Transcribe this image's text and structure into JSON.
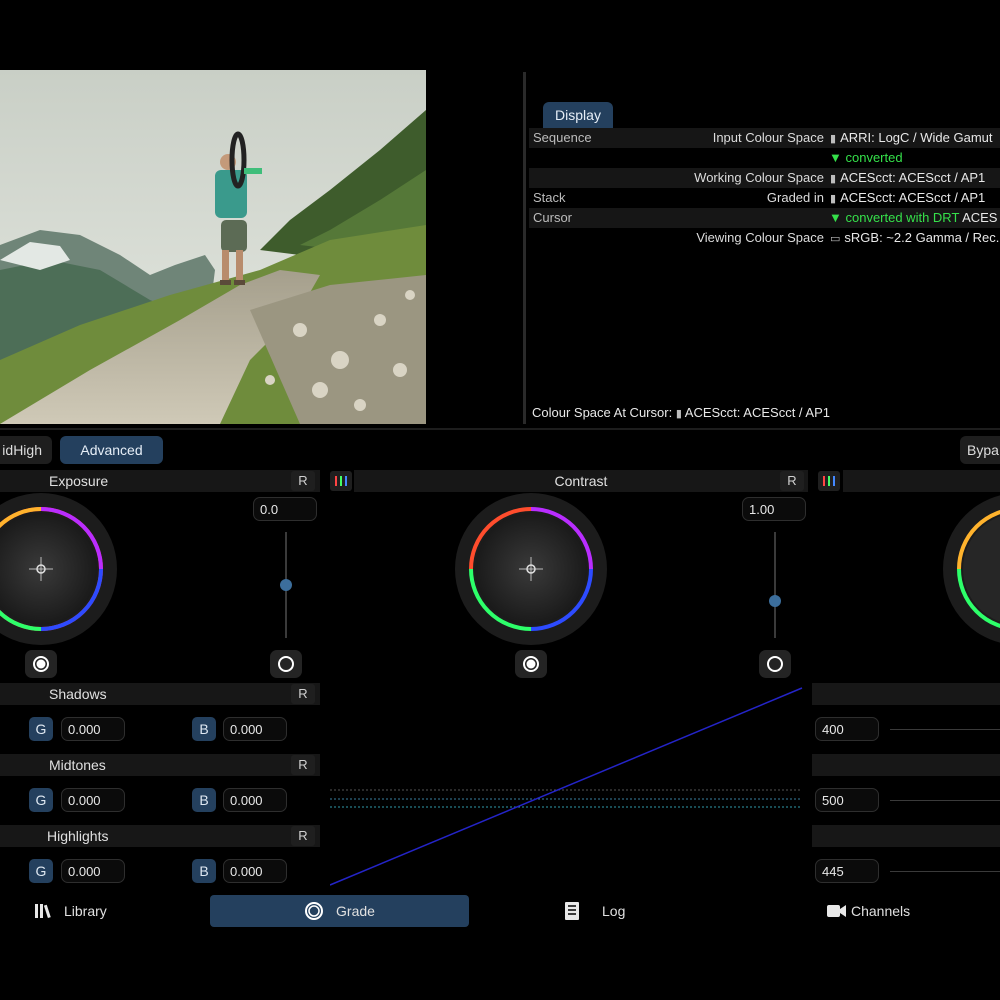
{
  "display_panel": {
    "tab_label": "Display",
    "rows": [
      {
        "left": "Sequence",
        "label": "Input Colour Space",
        "icon": "camera-icon",
        "value": "ARRI: LogC / Wide Gamut"
      },
      {
        "left": "",
        "label": "",
        "green": "converted",
        "white": ""
      },
      {
        "left": "",
        "label": "Working Colour Space",
        "icon": "camera-icon",
        "value": "ACEScct: ACEScct / AP1"
      },
      {
        "left": "Stack",
        "label": "Graded in",
        "icon": "camera-icon",
        "value": "ACEScct: ACEScct / AP1"
      },
      {
        "left": "Cursor",
        "label": "",
        "green": "converted with DRT",
        "white": "ACES"
      },
      {
        "left": "",
        "label": "Viewing Colour Space",
        "icon": "monitor-icon",
        "value": "sRGB: ~2.2 Gamma / Rec."
      }
    ],
    "cursor_prefix": "Colour Space At Cursor:",
    "cursor_value": "ACEScct: ACEScct / AP1"
  },
  "toolbar": {
    "midhigh_label": "idHigh",
    "advanced_label": "Advanced",
    "bypass_label": "Bypa"
  },
  "exposure": {
    "title": "Exposure",
    "reset": "R",
    "value": "0.0",
    "slider_level": 0.5
  },
  "contrast": {
    "title": "Contrast",
    "reset": "R",
    "value": "1.00",
    "slider_level": 0.35
  },
  "tones": [
    {
      "title": "Shadows",
      "reset": "R",
      "g_label": "G",
      "g_value": "0.000",
      "b_label": "B",
      "b_value": "0.000",
      "right_value": "400"
    },
    {
      "title": "Midtones",
      "reset": "R",
      "g_label": "G",
      "g_value": "0.000",
      "b_label": "B",
      "b_value": "0.000",
      "right_value": "500"
    },
    {
      "title": "Highlights",
      "reset": "R",
      "g_label": "G",
      "g_value": "0.000",
      "b_label": "B",
      "b_value": "0.000",
      "right_value": "445"
    }
  ],
  "nav": {
    "library": "Library",
    "grade": "Grade",
    "log": "Log",
    "channels": "Channels"
  },
  "colors": {
    "accent": "#24405e",
    "green_text": "#35e04a",
    "slider_knob": "#3c6e9c"
  }
}
